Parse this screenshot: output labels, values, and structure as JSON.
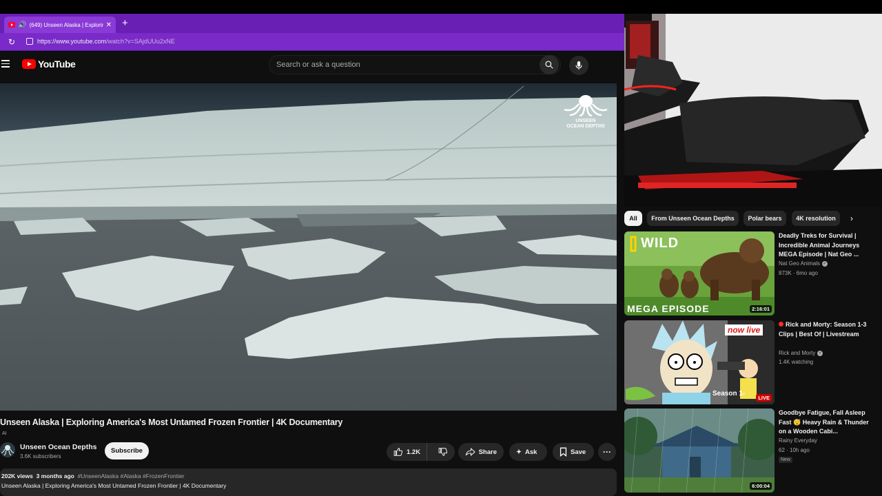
{
  "browser": {
    "tab_title": "(649) Unseen Alaska | Exploring",
    "url_host": "https://www.youtube.com",
    "url_path": "/watch?v=SAjdUUu2xNE"
  },
  "header": {
    "logo_text": "YouTube",
    "search_placeholder": "Search or ask a question"
  },
  "video": {
    "watermark_line1": "UNSEEN",
    "watermark_line2": "OCEAN DEPTHS",
    "title": "Unseen Alaska | Exploring America's Most Untamed Frozen Frontier | 4K Documentary",
    "ai_badge": "AI",
    "channel_name": "Unseen Ocean Depths",
    "subscribers": "3.6K subscribers",
    "subscribe_label": "Subscribe",
    "likes": "1.2K",
    "share_label": "Share",
    "ask_label": "Ask",
    "save_label": "Save",
    "views": "202K views",
    "age": "3 months ago",
    "hashtags": "#UnseenAlaska #Alaska #FrozenFrontier",
    "description_first_line": "Unseen Alaska | Exploring America's Most Untamed Frozen Frontier | 4K Documentary"
  },
  "chips": [
    "All",
    "From Unseen Ocean Depths",
    "Polar bears",
    "4K resolution"
  ],
  "recommendations": [
    {
      "title": "Deadly Treks for Survival | Incredible Animal Journeys MEGA Episode | Nat Geo ...",
      "channel": "Nat Geo Animals",
      "stats": "873K · 6mo ago",
      "duration": "2:16:01",
      "thumb_text_top": "WILD",
      "thumb_text_bottom": "MEGA EPISODE"
    },
    {
      "title": "Rick and Morty: Season 1-3 Clips | Best Of | Livestream",
      "channel": "Rick and Morty",
      "stats": "1.4K watching",
      "duration": "LIVE",
      "thumb_text_top": "now live",
      "thumb_text_bottom": "Season 1-"
    },
    {
      "title": "Goodbye Fatigue, Fall Asleep Fast 😴 Heavy Rain & Thunder on a Wooden Cabi...",
      "channel": "Rainy Everyday",
      "stats": "62 · 10h ago",
      "badge": "New",
      "duration": "6:00:04"
    }
  ],
  "colors": {
    "browser_accent": "#6a1fb4",
    "youtube_red": "#ff0000",
    "page_bg": "#0f0f0f"
  }
}
